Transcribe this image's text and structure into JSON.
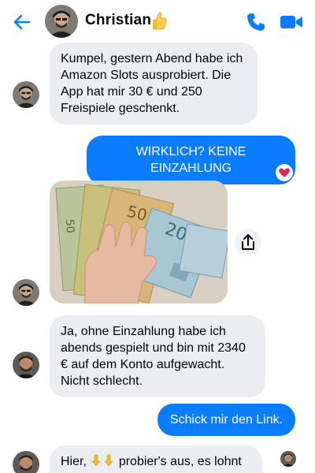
{
  "header": {
    "contact_name": "Christian",
    "status_emoji": "thumbs-up",
    "back_icon": "back-arrow-icon",
    "call_icon": "phone-icon",
    "video_icon": "video-camera-icon"
  },
  "colors": {
    "accent": "#0a7cff",
    "incoming_bubble": "#ebedf0",
    "heart": "#e0245e"
  },
  "messages": [
    {
      "direction": "in",
      "text": "Kumpel, gestern Abend habe ich Amazon Slots ausprobiert. Die App hat mir 30 € und 250 Freispiele geschenkt."
    },
    {
      "direction": "out",
      "text": "WIRKLICH? KEINE EINZAHLUNG",
      "reaction": "heart"
    },
    {
      "direction": "in",
      "type": "photo",
      "description_icon": "euro-banknotes-photo"
    },
    {
      "direction": "in",
      "text": "Ja, ohne Einzahlung habe ich abends gespielt und bin mit 2340 € auf dem Konto aufgewacht. Nicht schlecht."
    },
    {
      "direction": "out",
      "text": "Schick mir den Link."
    },
    {
      "direction": "in",
      "text_before": "Hier,",
      "text_after": "probier's aus, es lohnt"
    }
  ]
}
